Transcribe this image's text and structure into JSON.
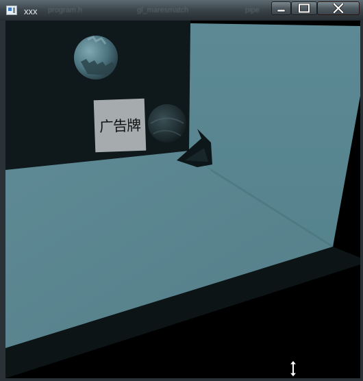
{
  "window": {
    "title": "xxx",
    "background_tabs": [
      "program.h",
      "gl_maresmatch",
      "pipe"
    ],
    "buttons": {
      "minimize": "minimize",
      "maximize": "maximize",
      "close": "close"
    }
  },
  "scene": {
    "billboard_text": "广告牌",
    "icons": {
      "app": "app-window-icon",
      "cursor": "vertical-resize-cursor-icon"
    },
    "colors": {
      "floor": "#5b8792",
      "right_wall": "#5a8794",
      "back_wall": "#0f181b",
      "floor_edge": "#0d1416",
      "void": "#000000",
      "billboard": "#a6acae",
      "sphere": "#4d7580"
    }
  }
}
